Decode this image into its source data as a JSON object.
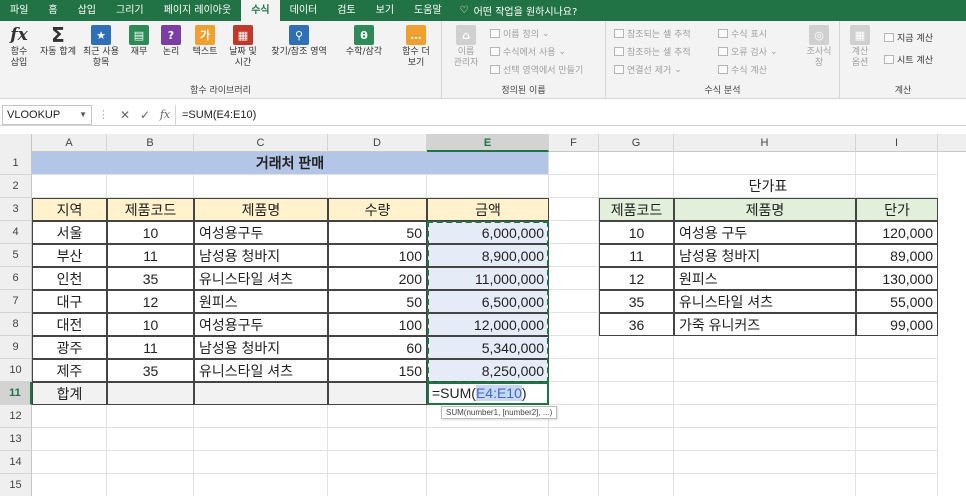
{
  "tabs": [
    "파일",
    "홈",
    "삽입",
    "그리기",
    "페이지 레이아웃",
    "수식",
    "데이터",
    "검토",
    "보기",
    "도움말"
  ],
  "active_tab": "수식",
  "tell_me": "어떤 작업을 원하시나요?",
  "ribbon": {
    "fx_label": "함수\n삽입",
    "autosum_label": "자동 합계",
    "recent_label": "최근 사용\n항목",
    "financial_label": "재무",
    "logical_label": "논리",
    "text_label": "텍스트",
    "datetime_label": "날짜 및\n시간",
    "lookup_label": "찾기/참조 영역",
    "math_label": "수학/삼각",
    "more_label": "함수 더\n보기",
    "library_group": "함수 라이브러리",
    "name_manager": "이름\n관리자",
    "define_name": "이름 정의",
    "use_in_formula": "수식에서 사용",
    "create_from_sel": "선택 영역에서 만들기",
    "names_group": "정의된 이름",
    "trace_precedents": "참조되는 셀 추적",
    "trace_dependents": "참조하는 셀 추적",
    "remove_arrows": "연결선 제거",
    "show_formulas": "수식 표시",
    "error_check": "오류 검사",
    "evaluate": "수식 계산",
    "watch_window": "조사식\n창",
    "audit_group": "수식 분석",
    "calc_options": "계산\n옵션",
    "calc_now": "지금 계산",
    "calc_sheet": "시트 계산",
    "calc_group": "계산"
  },
  "formula_bar": {
    "name_box": "VLOOKUP",
    "cancel": "✕",
    "enter": "✓",
    "fx": "fx",
    "formula": "=SUM(E4:E10)"
  },
  "columns": [
    "A",
    "B",
    "C",
    "D",
    "E",
    "F",
    "G",
    "H",
    "I"
  ],
  "rows": [
    "1",
    "2",
    "3",
    "4",
    "5",
    "6",
    "7",
    "8",
    "9",
    "10",
    "11",
    "12",
    "13",
    "14",
    "15"
  ],
  "sheet": {
    "title": "거래처 판매",
    "headers": [
      "지역",
      "제품코드",
      "제품명",
      "수량",
      "금액"
    ],
    "records": [
      [
        "서울",
        "10",
        "여성용구두",
        "50",
        "6,000,000"
      ],
      [
        "부산",
        "11",
        "남성용 청바지",
        "100",
        "8,900,000"
      ],
      [
        "인천",
        "35",
        "유니스타일 셔츠",
        "200",
        "11,000,000"
      ],
      [
        "대구",
        "12",
        "원피스",
        "50",
        "6,500,000"
      ],
      [
        "대전",
        "10",
        "여성용구두",
        "100",
        "12,000,000"
      ],
      [
        "광주",
        "11",
        "남성용 청바지",
        "60",
        "5,340,000"
      ],
      [
        "제주",
        "35",
        "유니스타일 셔츠",
        "150",
        "8,250,000"
      ]
    ],
    "total_label": "합계",
    "edit_prefix": "=SUM(",
    "edit_ref": "E4:E10",
    "edit_suffix": ")",
    "tooltip": "SUM(number1, [number2], ...)"
  },
  "price_table": {
    "title": "단가표",
    "headers": [
      "제품코드",
      "제품명",
      "단가"
    ],
    "records": [
      [
        "10",
        "여성용 구두",
        "120,000"
      ],
      [
        "11",
        "남성용 청바지",
        "89,000"
      ],
      [
        "12",
        "원피스",
        "130,000"
      ],
      [
        "35",
        "유니스타일 셔츠",
        "55,000"
      ],
      [
        "36",
        "가죽 유니커즈",
        "99,000"
      ]
    ]
  },
  "colors": {
    "accent": "#217346",
    "title_fill": "#b4c6e7",
    "header_yellow": "#fff2cc",
    "header_green": "#e2efda"
  }
}
